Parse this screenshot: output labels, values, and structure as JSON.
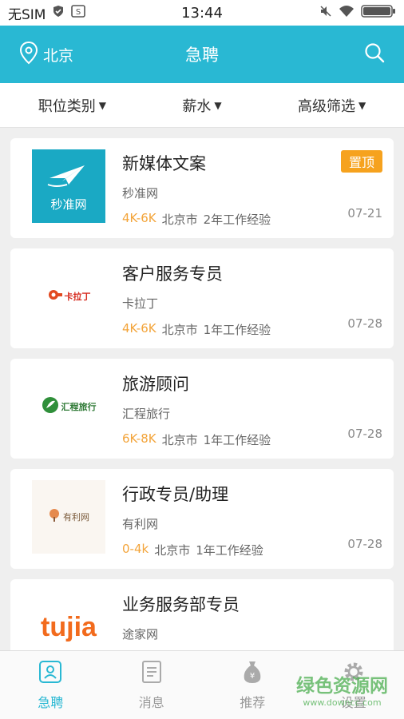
{
  "status": {
    "carrier": "无SIM",
    "time": "13:44"
  },
  "header": {
    "city": "北京",
    "title": "急聘"
  },
  "filters": [
    {
      "label": "职位类别"
    },
    {
      "label": "薪水"
    },
    {
      "label": "高级筛选"
    }
  ],
  "jobs": [
    {
      "title": "新媒体文案",
      "company": "秒准网",
      "salary": "4K-6K",
      "city": "北京市",
      "experience": "2年工作经验",
      "date": "07-21",
      "badge": "置顶",
      "logo_text": "秒准网"
    },
    {
      "title": "客户服务专员",
      "company": "卡拉丁",
      "salary": "4K-6K",
      "city": "北京市",
      "experience": "1年工作经验",
      "date": "07-28",
      "logo_text": "卡拉丁"
    },
    {
      "title": "旅游顾问",
      "company": "汇程旅行",
      "salary": "6K-8K",
      "city": "北京市",
      "experience": "1年工作经验",
      "date": "07-28",
      "logo_text": "汇程旅行"
    },
    {
      "title": "行政专员/助理",
      "company": "有利网",
      "salary": "0-4k",
      "city": "北京市",
      "experience": "1年工作经验",
      "date": "07-28",
      "logo_text": "有利网"
    },
    {
      "title": "业务服务部专员",
      "company": "途家网",
      "salary": "",
      "city": "",
      "experience": "",
      "date": "",
      "logo_text": "tujia"
    }
  ],
  "tabs": [
    {
      "label": "急聘",
      "icon": "job-icon",
      "active": true
    },
    {
      "label": "消息",
      "icon": "message-icon"
    },
    {
      "label": "推荐",
      "icon": "moneybag-icon"
    },
    {
      "label": "设置",
      "icon": "gear-icon"
    }
  ],
  "watermark": {
    "line1": "绿色资源网",
    "line2": "www.downcc.com"
  },
  "colors": {
    "primary": "#29b8d3",
    "salary": "#f3a43a",
    "badge": "#f6a21e"
  }
}
